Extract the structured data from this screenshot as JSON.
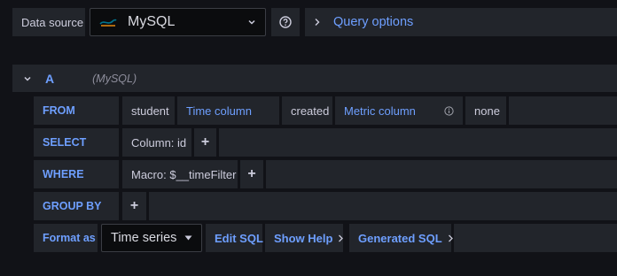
{
  "toolbar": {
    "data_source_label": "Data source",
    "datasource_name": "MySQL",
    "query_options_label": "Query options"
  },
  "query": {
    "ref_id": "A",
    "ref_datasource": "(MySQL)",
    "from": {
      "keyword": "FROM",
      "table": "student",
      "time_column_label": "Time column",
      "time_column_value": "created",
      "metric_column_label": "Metric column",
      "metric_column_value": "none"
    },
    "select": {
      "keyword": "SELECT",
      "column": "Column: id",
      "add": "+"
    },
    "where": {
      "keyword": "WHERE",
      "macro": "Macro: $__timeFilter",
      "add": "+"
    },
    "group_by": {
      "keyword": "GROUP BY",
      "add": "+"
    },
    "format": {
      "label": "Format as",
      "value": "Time series",
      "edit_sql": "Edit SQL",
      "show_help": "Show Help",
      "generated_sql": "Generated SQL"
    }
  },
  "colors": {
    "background": "#111217",
    "panel": "#22252b",
    "accent": "#6e9fff",
    "text": "#ccccdc"
  },
  "icons": [
    "mysql-logo",
    "chevron-down-icon",
    "help-circle-icon",
    "chevron-right-icon",
    "info-icon"
  ]
}
